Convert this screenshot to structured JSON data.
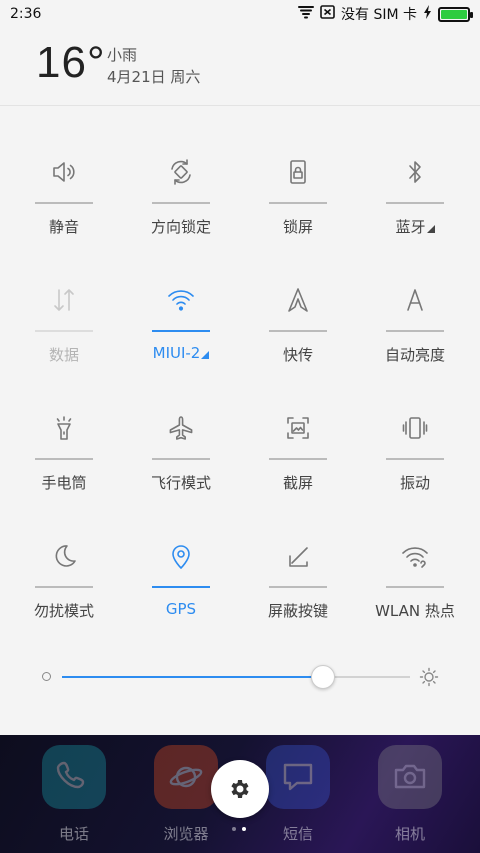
{
  "status_bar": {
    "time": "2:36",
    "no_sim_label": "没有 SIM 卡",
    "battery_level": 1.0,
    "battery_color": "#2ecc40"
  },
  "weather": {
    "temperature": "16°",
    "condition": "小雨",
    "date": "4月21日 周六"
  },
  "toggles": [
    {
      "label": "静音",
      "icon": "speaker-icon",
      "state": "off"
    },
    {
      "label": "方向锁定",
      "icon": "rotate-lock-icon",
      "state": "off"
    },
    {
      "label": "锁屏",
      "icon": "lock-screen-icon",
      "state": "off"
    },
    {
      "label": "蓝牙",
      "icon": "bluetooth-icon",
      "state": "off",
      "expandable": true
    },
    {
      "label": "数据",
      "icon": "data-arrows-icon",
      "state": "disabled"
    },
    {
      "label": "MIUI-2",
      "icon": "wifi-icon",
      "state": "on",
      "expandable": true
    },
    {
      "label": "快传",
      "icon": "quick-send-icon",
      "state": "off"
    },
    {
      "label": "自动亮度",
      "icon": "auto-brightness-icon",
      "state": "off"
    },
    {
      "label": "手电筒",
      "icon": "flashlight-icon",
      "state": "off"
    },
    {
      "label": "飞行模式",
      "icon": "airplane-icon",
      "state": "off"
    },
    {
      "label": "截屏",
      "icon": "screenshot-icon",
      "state": "off"
    },
    {
      "label": "振动",
      "icon": "vibrate-icon",
      "state": "off"
    },
    {
      "label": "勿扰模式",
      "icon": "moon-icon",
      "state": "off"
    },
    {
      "label": "GPS",
      "icon": "location-pin-icon",
      "state": "on"
    },
    {
      "label": "屏蔽按键",
      "icon": "block-keys-icon",
      "state": "off"
    },
    {
      "label": "WLAN 热点",
      "icon": "hotspot-icon",
      "state": "off"
    }
  ],
  "brightness": {
    "level": 0.75,
    "accent": "#2d8cf0"
  },
  "dock": {
    "apps": [
      {
        "label": "电话",
        "icon": "phone-icon",
        "color": "#1aa3b0"
      },
      {
        "label": "浏览器",
        "icon": "browser-icon",
        "color": "#e8501e"
      },
      {
        "label": "短信",
        "icon": "message-icon",
        "color": "#3a5bd9"
      },
      {
        "label": "相机",
        "icon": "camera-icon",
        "color": "#888888"
      }
    ],
    "page_count": 2,
    "current_page": 1
  }
}
